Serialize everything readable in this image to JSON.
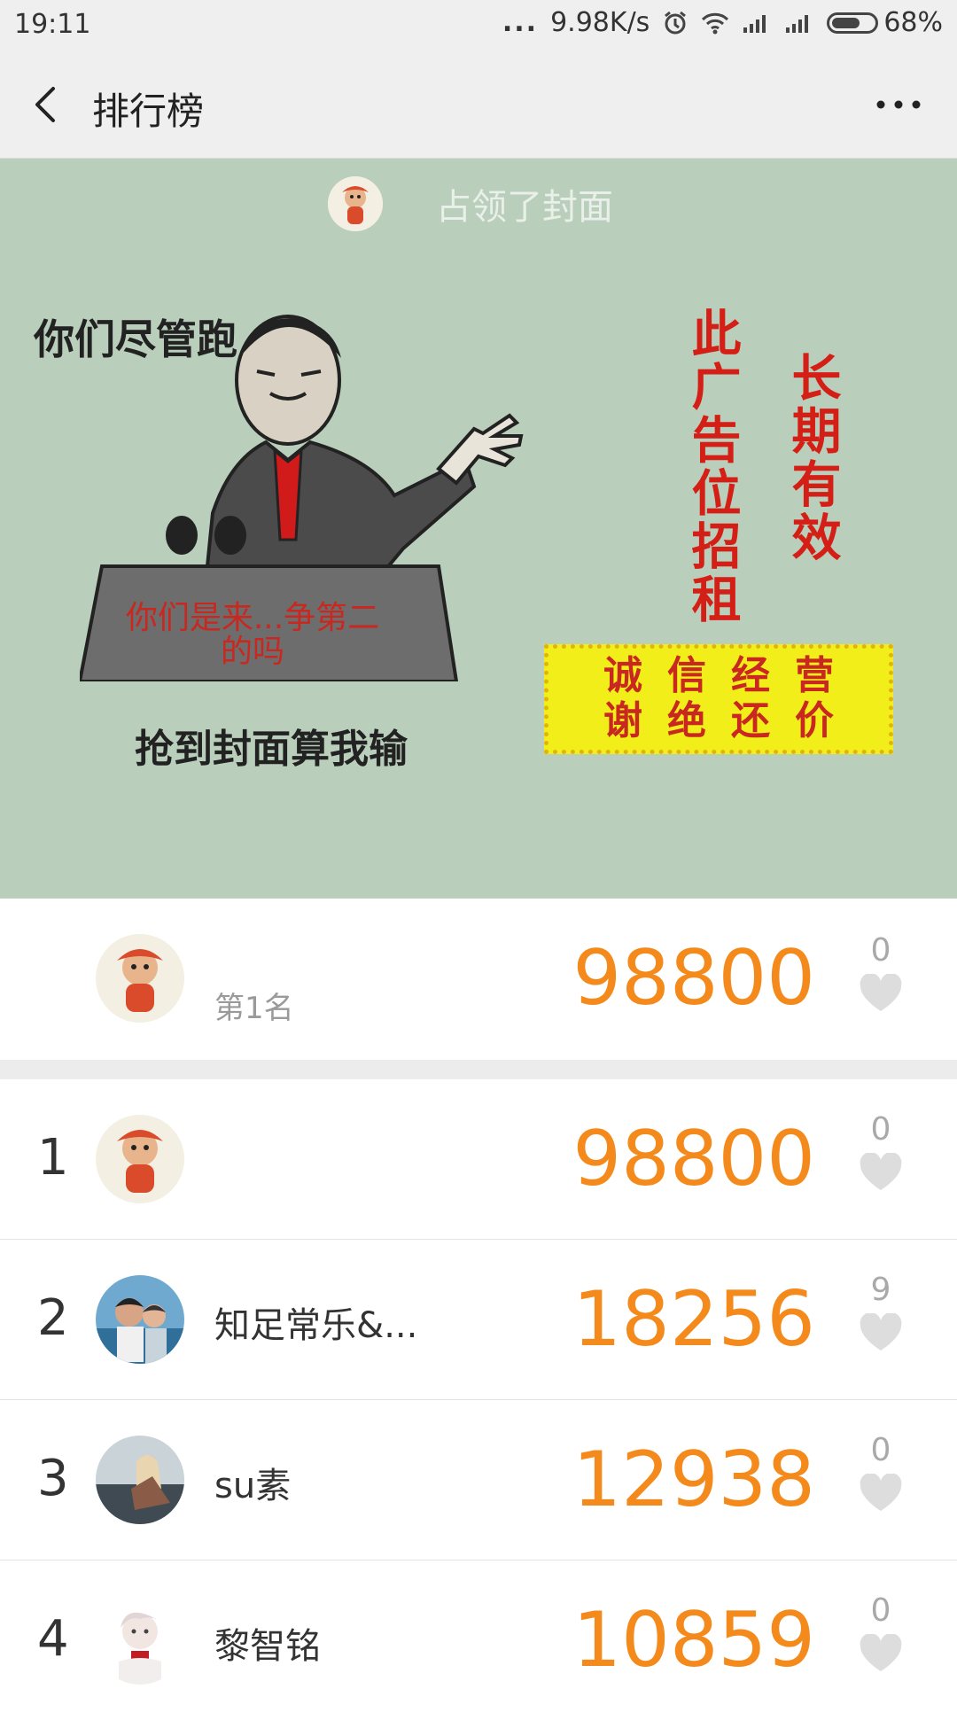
{
  "status_bar": {
    "time": "19:11",
    "dots": "...",
    "net_speed": "9.98K/s",
    "battery": "68%",
    "battery_level": 0.68,
    "icons": [
      "alarm-icon",
      "wifi-icon",
      "signal-icon",
      "signal-icon",
      "battery-icon"
    ]
  },
  "app_bar": {
    "title": "排行榜",
    "back_icon": "chevron-left-icon",
    "more_icon": "more-dots-icon"
  },
  "cover": {
    "owner_text": "占领了封面",
    "line1": "你们尽管跑",
    "line2": "抢到封面算我输",
    "podium_text": "你们是来...争第二的吗",
    "vertical_red_1": "此广告位招租",
    "vertical_red_2": "长期有效",
    "sign_line1": "诚信经营",
    "sign_line2": "谢绝还价"
  },
  "top_entry": {
    "label": "第1名",
    "score": "98800",
    "likes": "0"
  },
  "ranking": [
    {
      "rank": "1",
      "name": "",
      "score": "98800",
      "likes": "0"
    },
    {
      "rank": "2",
      "name": "知足常乐&...",
      "score": "18256",
      "likes": "9"
    },
    {
      "rank": "3",
      "name": "su素",
      "score": "12938",
      "likes": "0"
    },
    {
      "rank": "4",
      "name": "黎智铭",
      "score": "10859",
      "likes": "0"
    }
  ],
  "colors": {
    "score": "#f48a1c",
    "cover_bg": "#b9cfbb",
    "bar_bg": "#efefef",
    "heart": "#dddddd"
  }
}
